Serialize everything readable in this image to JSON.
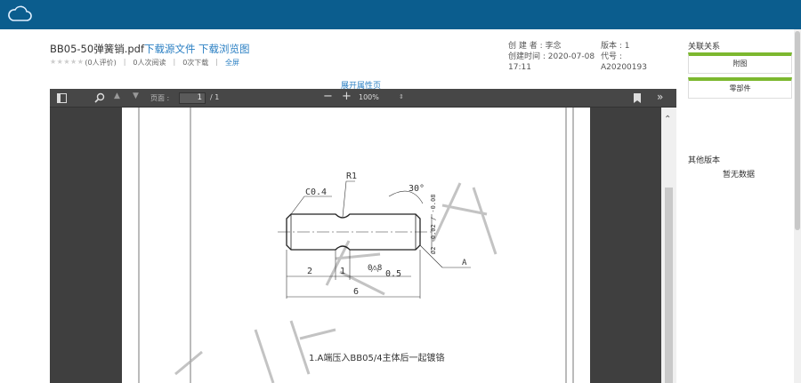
{
  "header": {
    "cloud_icon": "cloud-icon"
  },
  "file": {
    "name": "BB05-50弹簧销.pdf",
    "download_source": "下载源文件",
    "download_preview": "下载浏览图",
    "stars": "★★★★★",
    "rating": "(0人评价)",
    "reads": "0人次阅读",
    "downloads": "0次下载",
    "fullscreen": "全屏"
  },
  "meta": {
    "creator_label": "创 建 者 : 李念",
    "created_time_label": "创建时间 : 2020-07-08",
    "created_time_clock": "17:11",
    "version_label": "版本 : 1",
    "code_label": "代号 :",
    "code_value": "A20200193"
  },
  "expand_props": "展开属性页",
  "pdf_toolbar": {
    "page_label": "页面 :",
    "page_current": "1",
    "page_total": "/ 1",
    "zoom": "100%",
    "zoom_minus": "−",
    "zoom_plus": "+"
  },
  "drawing": {
    "chamfer": "C0.4",
    "radius": "R1",
    "angle": "30°",
    "dim_2": "2",
    "dim_1": "1",
    "dim_0_8": "0.8",
    "dim_0_5": "0.5",
    "dim_6": "6",
    "tolerance": "Ø2 -0.02 / -0.08",
    "note": "1.A端压入BB05/4主体后一起镀铬",
    "ref_a": "A",
    "watermark": "数控文件"
  },
  "sidebar": {
    "relations_title": "关联关系",
    "attachment_btn": "附图",
    "parts_btn": "零部件",
    "other_versions": "其他版本",
    "no_data": "暂无数据"
  }
}
